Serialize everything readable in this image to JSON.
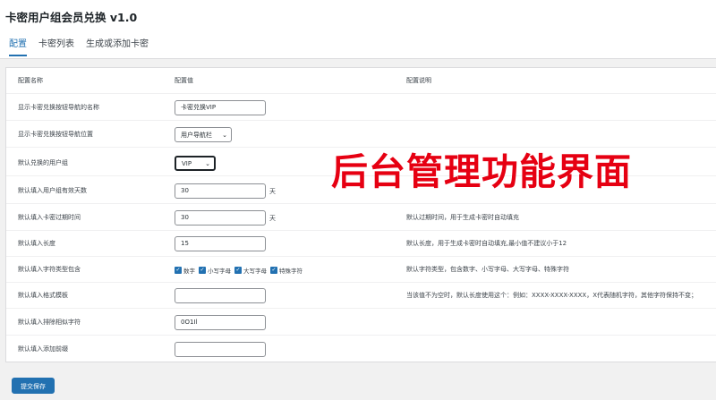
{
  "header": {
    "title": "卡密用户组会员兑换 v1.0",
    "tabs": [
      {
        "label": "配置",
        "active": true
      },
      {
        "label": "卡密列表",
        "active": false
      },
      {
        "label": "生成或添加卡密",
        "active": false
      }
    ]
  },
  "table": {
    "columns": {
      "name": "配置名称",
      "value": "配置值",
      "desc": "配置说明"
    },
    "rows": [
      {
        "name": "显示卡密兑换按钮导航的名称",
        "value": "卡密兑换VIP",
        "desc": ""
      },
      {
        "name": "显示卡密兑换按钮导航位置",
        "value": "用户导航栏",
        "desc": ""
      },
      {
        "name": "默认兑换的用户组",
        "value": "VIP",
        "desc": ""
      },
      {
        "name": "默认填入用户组有效天数",
        "value": "30",
        "unit": "天",
        "desc": ""
      },
      {
        "name": "默认填入卡密过期时间",
        "value": "30",
        "unit": "天",
        "desc": "默认过期时间，用于生成卡密时自动填充"
      },
      {
        "name": "默认填入长度",
        "value": "15",
        "desc": "默认长度，用于生成卡密时自动填充,最小值不建议小于12"
      },
      {
        "name": "默认填入字符类型包含",
        "options": [
          "数字",
          "小写字母",
          "大写字母",
          "特殊字符"
        ],
        "desc": "默认字符类型，包含数字、小写字母、大写字母、特殊字符"
      },
      {
        "name": "默认填入格式模板",
        "value": "",
        "desc": "当该值不为空时，默认长度使用这个：例如：XXXX-XXXX-XXXX，X代表随机字符，其他字符保持不变；"
      },
      {
        "name": "默认填入排除相似字符",
        "value": "0O1Il",
        "desc": ""
      },
      {
        "name": "默认填入添加前缀",
        "value": "",
        "desc": ""
      }
    ]
  },
  "overlay_text": "后台管理功能界面",
  "submit_label": "提交保存",
  "colors": {
    "accent": "#2271b1",
    "overlay": "#e60012",
    "background": "#f1f1f1"
  }
}
